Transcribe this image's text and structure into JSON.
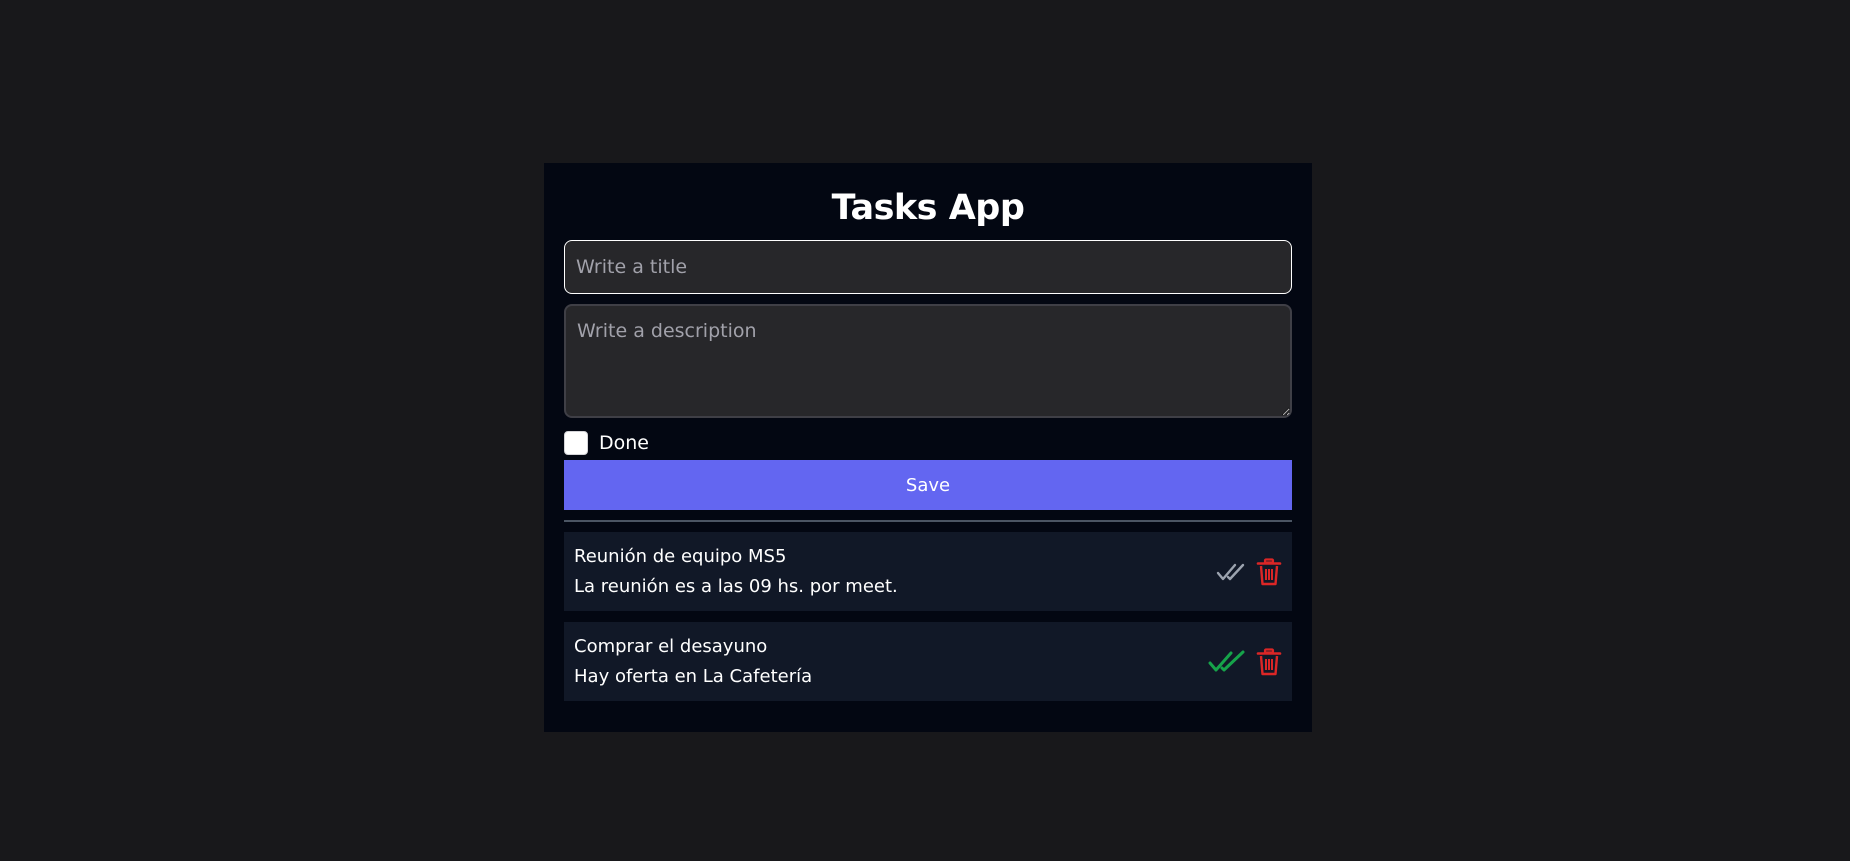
{
  "app": {
    "title": "Tasks App"
  },
  "form": {
    "title_placeholder": "Write a title",
    "title_value": "",
    "description_placeholder": "Write a description",
    "description_value": "",
    "done_label": "Done",
    "done_checked": false,
    "save_label": "Save"
  },
  "tasks": [
    {
      "title": "Reunión de equipo MS5",
      "description": "La reunión es a las 09 hs. por meet.",
      "done": false
    },
    {
      "title": "Comprar el desayuno",
      "description": "Hay oferta en La Cafetería",
      "done": true
    }
  ],
  "colors": {
    "page_background": "#18181b",
    "card_background": "#030712",
    "accent": "#6366f1",
    "task_background": "#111827",
    "done_check": "#16a34a",
    "undone_check": "#9ca3af",
    "delete": "#dc2626"
  },
  "icons": {
    "toggle_done": "double-check-icon",
    "delete": "trash-icon"
  }
}
